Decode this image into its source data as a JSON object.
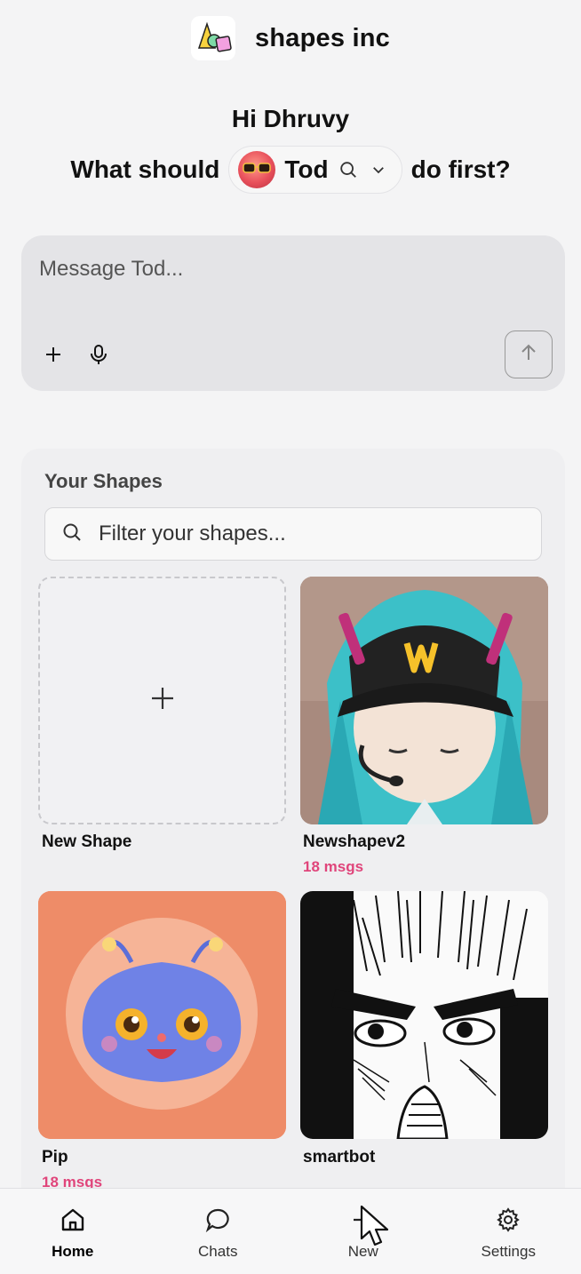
{
  "header": {
    "brand": "shapes inc",
    "logo_icon": "shapes-logo-icon"
  },
  "greeting": "Hi Dhruvy",
  "prompt": {
    "before": "What should",
    "shape_name": "Tod",
    "after": "do first?"
  },
  "composer": {
    "placeholder": "Message Tod...",
    "tools": [
      "plus-icon",
      "microphone-icon"
    ],
    "send_icon": "arrow-up-icon"
  },
  "shapes": {
    "title": "Your Shapes",
    "filter_placeholder": "Filter your shapes...",
    "items": [
      {
        "label": "New Shape",
        "sub": ""
      },
      {
        "label": "Newshapev2",
        "sub": "18 msgs"
      },
      {
        "label": "Pip",
        "sub": "18 msgs"
      },
      {
        "label": "smartbot",
        "sub": ""
      }
    ]
  },
  "nav": {
    "items": [
      {
        "label": "Home",
        "icon": "home-icon",
        "active": true
      },
      {
        "label": "Chats",
        "icon": "chat-bubble-icon",
        "active": false
      },
      {
        "label": "New",
        "icon": "plus-icon",
        "active": false
      },
      {
        "label": "Settings",
        "icon": "gear-icon",
        "active": false
      }
    ]
  },
  "colors": {
    "accent": "#e0457b",
    "background": "#f4f4f5",
    "composer": "#e4e4e7"
  }
}
